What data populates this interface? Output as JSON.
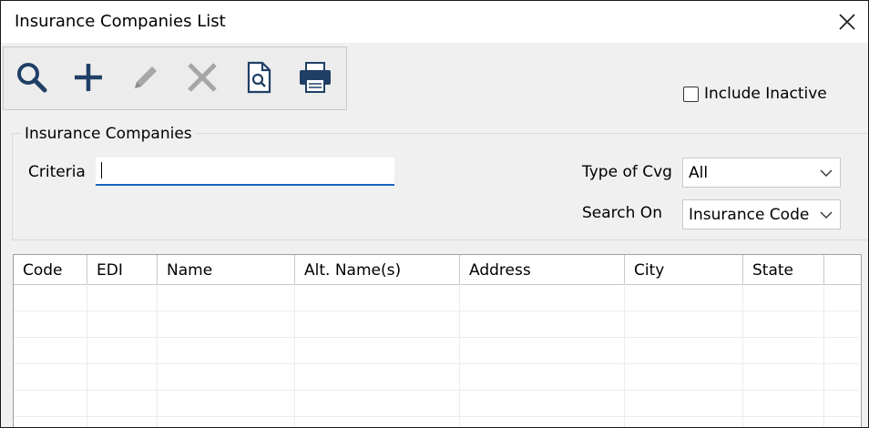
{
  "window": {
    "title": "Insurance Companies List"
  },
  "toolbar": {
    "buttons": [
      {
        "icon": "search-icon"
      },
      {
        "icon": "plus-icon"
      },
      {
        "icon": "pencil-icon"
      },
      {
        "icon": "x-delete-icon"
      },
      {
        "icon": "preview-document-icon"
      },
      {
        "icon": "printer-icon"
      }
    ]
  },
  "include_inactive": {
    "label": "Include Inactive",
    "checked": false
  },
  "filter": {
    "group_title": "Insurance Companies",
    "criteria_label": "Criteria",
    "criteria_value": "",
    "type_of_cvg_label": "Type of Cvg",
    "type_of_cvg_value": "All",
    "search_on_label": "Search On",
    "search_on_value": "Insurance Code"
  },
  "grid": {
    "columns": [
      "Code",
      "EDI",
      "Name",
      "Alt. Name(s)",
      "Address",
      "City",
      "State"
    ],
    "rows": []
  },
  "colors": {
    "accent": "#1565c0",
    "icon_blue": "#1f3f66",
    "icon_disabled": "#a6a6a6"
  }
}
